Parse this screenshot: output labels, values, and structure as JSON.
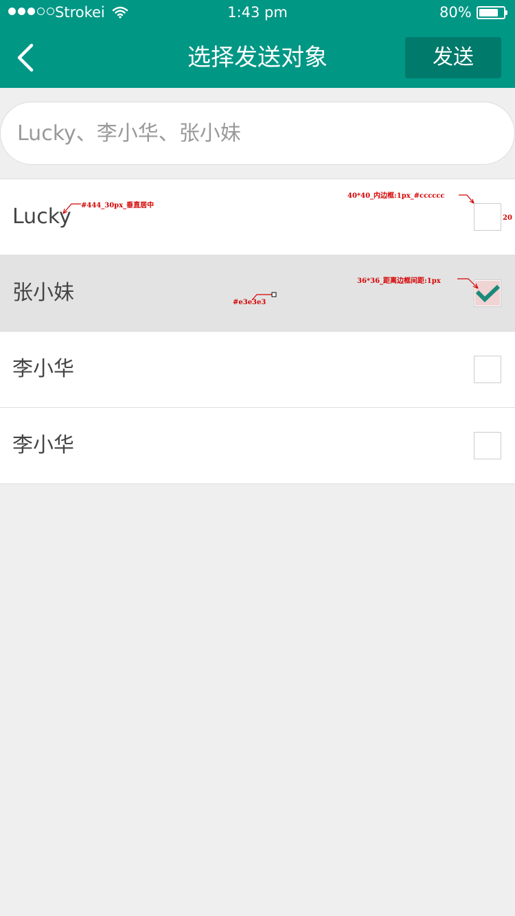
{
  "status_bar": {
    "carrier": "Strokei",
    "time": "1:43 pm",
    "battery_percent": "80%",
    "battery_level": 0.8,
    "signal_bars_filled": 3,
    "signal_bars_total": 5,
    "icons": [
      "signal-dots-icon",
      "wifi-icon",
      "battery-icon"
    ]
  },
  "nav": {
    "title": "选择发送对象",
    "back_icon": "chevron-left-icon",
    "send_label": "发送"
  },
  "search": {
    "value": "",
    "placeholder": "Lucky、李小华、张小妹"
  },
  "contacts": [
    {
      "name": "Lucky",
      "checked": false,
      "highlighted": false
    },
    {
      "name": "张小妹",
      "checked": true,
      "highlighted": true
    },
    {
      "name": "李小华",
      "checked": false,
      "highlighted": false
    },
    {
      "name": "李小华",
      "checked": false,
      "highlighted": false
    }
  ],
  "annotations": {
    "name_text": "#444_30px_垂直居中",
    "checkbox_box": "40*40_内边框:1px_#cccccc",
    "checkbox_margin": "20",
    "checkbox_inner": "36*36_距离边框间距:1px",
    "row_bg": "#e3e3e3"
  },
  "colors": {
    "header": "#009785",
    "send_button": "#007a6b",
    "selected_row": "#e3e3e3",
    "text": "#444444",
    "checkbox_border": "#cccccc",
    "check_mark": "#1a8a7a",
    "annotation": "#d40000"
  }
}
